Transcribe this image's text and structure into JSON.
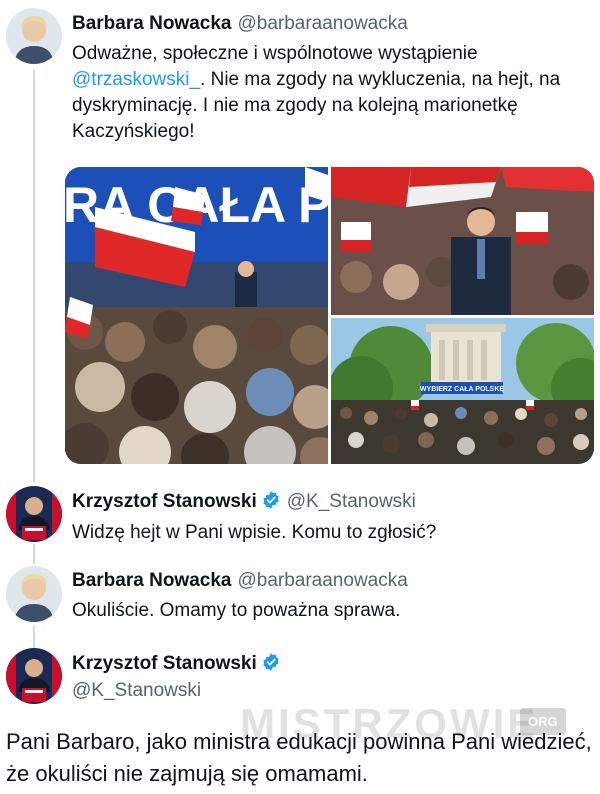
{
  "tweets": [
    {
      "name": "Barbara Nowacka",
      "handle": "@barbaraanowacka",
      "text_before_mention": "Odważne, społeczne i wspólnotowe wystąpienie",
      "mention": "@trzaskowski_",
      "text_after_mention": ". Nie ma zgody na wykluczenia, na hejt, na dyskryminację. I nie ma zgody na kolejną marionetkę Kaczyńskiego!",
      "media": [
        {
          "banner_text": "RA CAŁA POL"
        },
        {
          "banner_text": ""
        },
        {
          "banner_text": "WYBIERZ CAŁA POLSKĘ"
        }
      ]
    },
    {
      "name": "Krzysztof Stanowski",
      "handle": "@K_Stanowski",
      "verified": true,
      "text": "Widzę hejt w Pani wpisie. Komu to zgłosić?"
    },
    {
      "name": "Barbara Nowacka",
      "handle": "@barbaraanowacka",
      "text": "Okuliście. Omamy to poważna sprawa."
    },
    {
      "name": "Krzysztof Stanowski",
      "handle": "@K_Stanowski",
      "verified": true,
      "text": "Pani Barbaro, jako ministra edukacji powinna Pani wiedzieć, że okuliści nie zajmują się omamami."
    }
  ],
  "watermark": {
    "text": "MISTRZOWIE",
    "tag": "ORG"
  },
  "colors": {
    "mention": "#1d9bf0",
    "verified": "#1d9bf0",
    "thread_line": "#cfd9de",
    "handle": "#536471"
  }
}
